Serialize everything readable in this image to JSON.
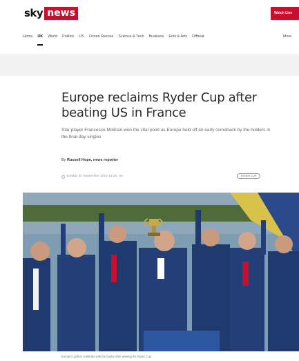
{
  "header": {
    "logo_sky": "sky",
    "logo_news": "news",
    "watch_live": "Watch Live",
    "nav": [
      {
        "label": "Home",
        "active": false
      },
      {
        "label": "UK",
        "active": true
      },
      {
        "label": "World",
        "active": false
      },
      {
        "label": "Politics",
        "active": false
      },
      {
        "label": "US",
        "active": false
      },
      {
        "label": "Ocean Rescue",
        "active": false
      },
      {
        "label": "Science & Tech",
        "active": false
      },
      {
        "label": "Business",
        "active": false
      },
      {
        "label": "Ents & Arts",
        "active": false
      },
      {
        "label": "Offbeat",
        "active": false
      }
    ],
    "nav_more": "More"
  },
  "article": {
    "headline": "Europe reclaims Ryder Cup after beating US in France",
    "standfirst": "Star player Francesco Molinari won the vital point as Europe held off an early comeback by the holders in the final-day singles",
    "byline_prefix": "By",
    "byline_author": "Russell Hope, news reporter",
    "dateline": "Sunday 30 September 2018 16:25, UK",
    "tag": "RYDER CUP",
    "hero_caption": "Europe's golfers celebrate with the trophy after winning the Ryder Cup"
  },
  "colors": {
    "brand_red": "#c8102e",
    "team_navy": "#1f3a6e"
  },
  "icons": {
    "clock": "clock-icon",
    "trophy": "trophy-icon"
  }
}
